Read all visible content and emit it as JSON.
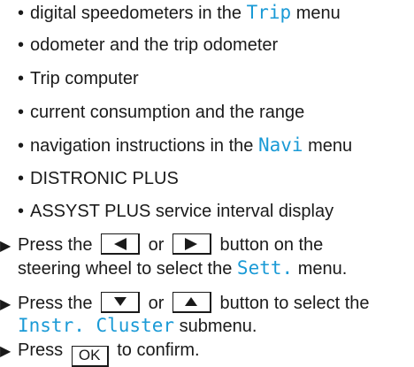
{
  "bullets": [
    {
      "before": "digital speedometers in the ",
      "term": "Trip",
      "after": " menu"
    },
    {
      "before": "odometer and the trip odometer",
      "term": "",
      "after": ""
    },
    {
      "before": "Trip computer",
      "term": "",
      "after": ""
    },
    {
      "before": "current consumption and the range",
      "term": "",
      "after": ""
    },
    {
      "before": "navigation instructions in the ",
      "term": "Navi",
      "after": " menu"
    },
    {
      "before": "DISTRONIC PLUS",
      "term": "",
      "after": ""
    },
    {
      "before": "ASSYST PLUS service interval display",
      "term": "",
      "after": ""
    }
  ],
  "bullet_char": "•",
  "step_marker": "▶",
  "steps": {
    "step1": {
      "press": "Press the",
      "or": "or",
      "tail": "button on the",
      "line2_before": "steering wheel to select the ",
      "term": "Sett.",
      "line2_after": " menu.",
      "key_left": "left-arrow-icon",
      "key_right": "right-arrow-icon"
    },
    "step2": {
      "press": "Press the",
      "or": "or",
      "tail": "button to select the",
      "term": "Instr. Cluster",
      "line2_after": " submenu.",
      "key_down": "down-arrow-icon",
      "key_up": "up-arrow-icon"
    },
    "step3": {
      "press": "Press",
      "key_label": "OK",
      "tail": "to confirm."
    }
  },
  "colors": {
    "term": "#1a9ad6",
    "text": "#1a1a1a"
  }
}
